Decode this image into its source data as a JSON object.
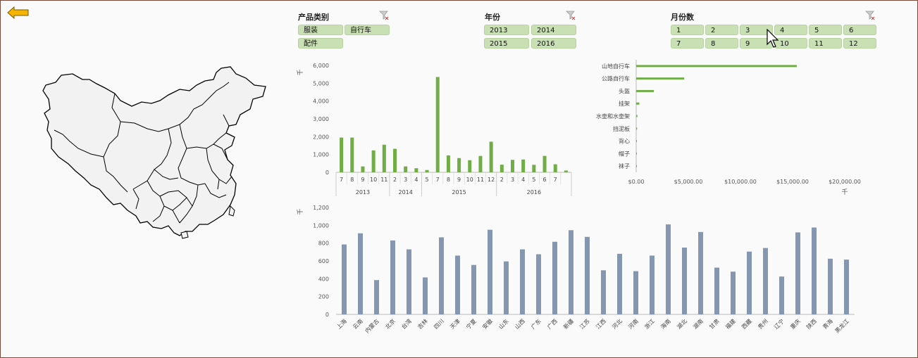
{
  "slicers": {
    "category": {
      "title": "产品类别",
      "items": [
        "服装",
        "自行车",
        "配件"
      ]
    },
    "year": {
      "title": "年份",
      "items": [
        "2013",
        "2014",
        "2015",
        "2016"
      ]
    },
    "month": {
      "title": "月份数",
      "items": [
        "1",
        "2",
        "3",
        "4",
        "5",
        "6",
        "7",
        "8",
        "9",
        "10",
        "11",
        "12"
      ]
    }
  },
  "colors": {
    "green": "#70ad47",
    "blue": "#8496b0",
    "slicer_bg": "#c9e0b4",
    "back_arrow": "#f4b400"
  },
  "chart_data": [
    {
      "type": "bar",
      "name": "monthly_sales",
      "unit_label": "千",
      "ylim": [
        0,
        6000
      ],
      "yticks": [
        "0",
        "1,000",
        "2,000",
        "3,000",
        "4,000",
        "5,000",
        "6,000"
      ],
      "groups": [
        {
          "year": "2013",
          "months": [
            "7",
            "8",
            "9",
            "10",
            "11"
          ],
          "values": [
            1950,
            1950,
            330,
            1230,
            1550
          ]
        },
        {
          "year": "2014",
          "months": [
            "2",
            "3",
            "4"
          ],
          "values": [
            1320,
            330,
            230
          ]
        },
        {
          "year": "2015",
          "months": [
            "5",
            "7",
            "8",
            "9",
            "10",
            "11",
            "12"
          ],
          "values": [
            130,
            5350,
            950,
            800,
            680,
            920,
            1720
          ]
        },
        {
          "year": "2016",
          "months": [
            "2",
            "3",
            "4",
            "5",
            "6",
            "7"
          ],
          "values": [
            430,
            700,
            720,
            420,
            920,
            450,
            100
          ]
        }
      ]
    },
    {
      "type": "bar",
      "orientation": "horizontal",
      "name": "product_sales",
      "unit_label": "千",
      "xlim": [
        0,
        20000
      ],
      "xticks": [
        "$0.00",
        "$5,000.00",
        "$10,000.00",
        "$15,000.00",
        "$20,000.00"
      ],
      "categories": [
        "山地自行车",
        "公路自行车",
        "头盔",
        "挂架",
        "水壶和水壶架",
        "挡泥板",
        "背心",
        "帽子",
        "袜子"
      ],
      "values": [
        15400,
        4600,
        1700,
        300,
        120,
        90,
        70,
        50,
        30
      ]
    },
    {
      "type": "bar",
      "name": "province_sales",
      "unit_label": "千",
      "ylim": [
        0,
        1200
      ],
      "yticks": [
        "0",
        "200",
        "400",
        "600",
        "800",
        "1,000",
        "1,200"
      ],
      "categories": [
        "上海",
        "云南",
        "内蒙古",
        "北京",
        "台湾",
        "吉林",
        "四川",
        "天津",
        "宁夏",
        "安徽",
        "山东",
        "山西",
        "广东",
        "广西",
        "新疆",
        "江苏",
        "江西",
        "河北",
        "河南",
        "浙江",
        "海南",
        "湖北",
        "湖南",
        "甘肃",
        "福建",
        "西藏",
        "贵州",
        "辽宁",
        "重庆",
        "陕西",
        "青海",
        "黑龙江"
      ],
      "values": [
        785,
        910,
        385,
        830,
        730,
        415,
        865,
        660,
        555,
        950,
        595,
        730,
        675,
        815,
        945,
        870,
        495,
        680,
        485,
        660,
        1010,
        750,
        925,
        525,
        480,
        705,
        745,
        425,
        920,
        975,
        625,
        615
      ]
    }
  ]
}
